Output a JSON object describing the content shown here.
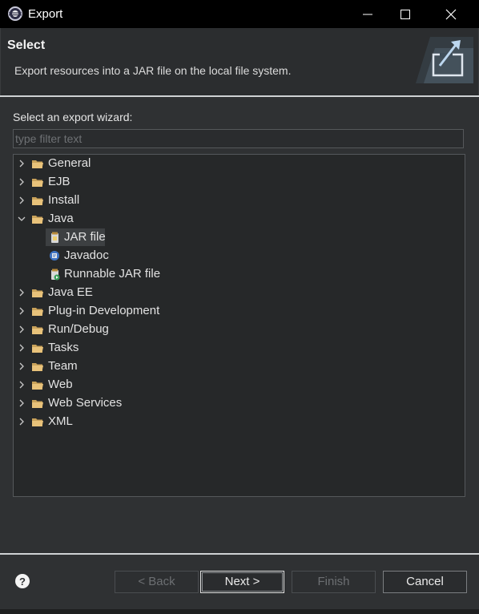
{
  "window": {
    "title": "Export",
    "icon": "eclipse-app-icon"
  },
  "header": {
    "title": "Select",
    "description": "Export resources into a JAR file on the local file system.",
    "banner_icon": "export-wizard-banner-icon"
  },
  "wizard": {
    "label": "Select an export wizard:",
    "filter_placeholder": "type filter text",
    "filter_value": "",
    "tree": [
      {
        "label": "General",
        "expanded": false
      },
      {
        "label": "EJB",
        "expanded": false
      },
      {
        "label": "Install",
        "expanded": false
      },
      {
        "label": "Java",
        "expanded": true,
        "children": [
          {
            "label": "JAR file",
            "icon": "jar-file-icon",
            "selected": true
          },
          {
            "label": "Javadoc",
            "icon": "javadoc-icon",
            "selected": false
          },
          {
            "label": "Runnable JAR file",
            "icon": "runnable-jar-icon",
            "selected": false
          }
        ]
      },
      {
        "label": "Java EE",
        "expanded": false
      },
      {
        "label": "Plug-in Development",
        "expanded": false
      },
      {
        "label": "Run/Debug",
        "expanded": false
      },
      {
        "label": "Tasks",
        "expanded": false
      },
      {
        "label": "Team",
        "expanded": false
      },
      {
        "label": "Web",
        "expanded": false
      },
      {
        "label": "Web Services",
        "expanded": false
      },
      {
        "label": "XML",
        "expanded": false
      }
    ]
  },
  "buttons": {
    "back": "< Back",
    "next": "Next >",
    "finish": "Finish",
    "cancel": "Cancel"
  },
  "colors": {
    "background": "#2f3133",
    "tree_background": "#262829",
    "folder": "#e8c27a"
  }
}
